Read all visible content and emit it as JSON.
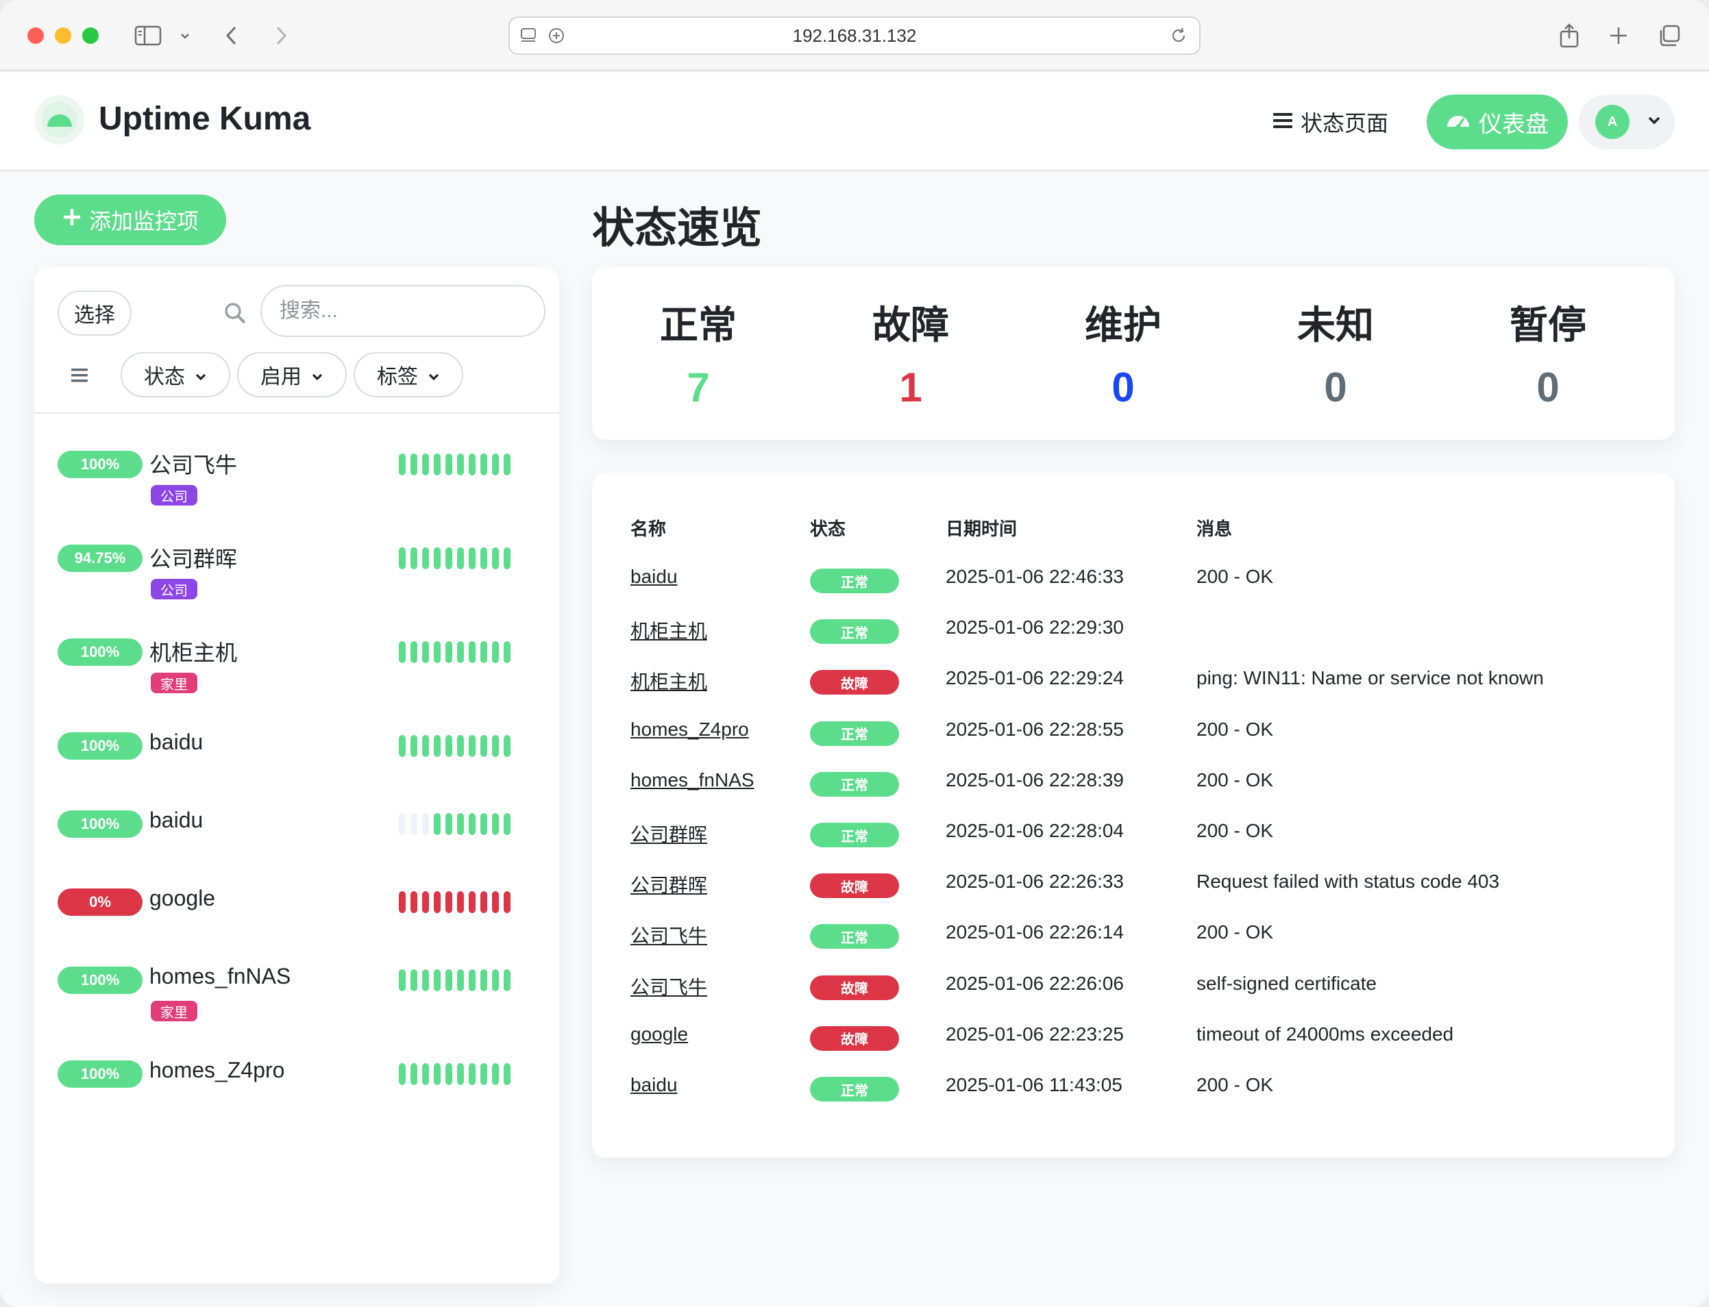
{
  "colors": {
    "up": "#5cdd8b",
    "down": "#dc3545",
    "maintenance": "#1747f5",
    "unknown": "#5f6b75",
    "pending": "#5f6b75",
    "tag_company": "#8c46e6",
    "tag_home": "#e13d78",
    "beat_empty": "#eef3f9"
  },
  "browser": {
    "address": "192.168.31.132"
  },
  "header": {
    "brand": "Uptime Kuma",
    "status_page": "状态页面",
    "dashboard": "仪表盘",
    "avatar_letter": "A"
  },
  "sidebar": {
    "add_monitor": "添加监控项",
    "select": "选择",
    "search_placeholder": "搜索...",
    "filters": [
      "状态",
      "启用",
      "标签"
    ],
    "monitors": [
      {
        "uptime": "100%",
        "name": "公司飞牛",
        "tag": "公司",
        "tag_type": "company",
        "status": "up",
        "beats": [
          "up",
          "up",
          "up",
          "up",
          "up",
          "up",
          "up",
          "up",
          "up",
          "up"
        ]
      },
      {
        "uptime": "94.75%",
        "name": "公司群晖",
        "tag": "公司",
        "tag_type": "company",
        "status": "up",
        "beats": [
          "up",
          "up",
          "up",
          "up",
          "up",
          "up",
          "up",
          "up",
          "up",
          "up"
        ]
      },
      {
        "uptime": "100%",
        "name": "机柜主机",
        "tag": "家里",
        "tag_type": "home",
        "status": "up",
        "beats": [
          "up",
          "up",
          "up",
          "up",
          "up",
          "up",
          "up",
          "up",
          "up",
          "up"
        ]
      },
      {
        "uptime": "100%",
        "name": "baidu",
        "tag": "",
        "tag_type": "",
        "status": "up",
        "beats": [
          "up",
          "up",
          "up",
          "up",
          "up",
          "up",
          "up",
          "up",
          "up",
          "up"
        ]
      },
      {
        "uptime": "100%",
        "name": "baidu",
        "tag": "",
        "tag_type": "",
        "status": "up",
        "beats": [
          "empty",
          "empty",
          "empty",
          "up",
          "up",
          "up",
          "up",
          "up",
          "up",
          "up"
        ]
      },
      {
        "uptime": "0%",
        "name": "google",
        "tag": "",
        "tag_type": "",
        "status": "down",
        "beats": [
          "down",
          "down",
          "down",
          "down",
          "down",
          "down",
          "down",
          "down",
          "down",
          "down"
        ]
      },
      {
        "uptime": "100%",
        "name": "homes_fnNAS",
        "tag": "家里",
        "tag_type": "home",
        "status": "up",
        "beats": [
          "up",
          "up",
          "up",
          "up",
          "up",
          "up",
          "up",
          "up",
          "up",
          "up"
        ]
      },
      {
        "uptime": "100%",
        "name": "homes_Z4pro",
        "tag": "",
        "tag_type": "",
        "status": "up",
        "beats": [
          "up",
          "up",
          "up",
          "up",
          "up",
          "up",
          "up",
          "up",
          "up",
          "up"
        ]
      }
    ]
  },
  "main": {
    "title": "状态速览",
    "stats": [
      {
        "label": "正常",
        "value": "7",
        "color": "#5cdd8b"
      },
      {
        "label": "故障",
        "value": "1",
        "color": "#dc3545"
      },
      {
        "label": "维护",
        "value": "0",
        "color": "#1747f5"
      },
      {
        "label": "未知",
        "value": "0",
        "color": "#5f6b75"
      },
      {
        "label": "暂停",
        "value": "0",
        "color": "#5f6b75"
      }
    ],
    "events_headers": [
      "名称",
      "状态",
      "日期时间",
      "消息"
    ],
    "events": [
      {
        "name": "baidu",
        "status": "正常",
        "type": "up",
        "time": "2025-01-06 22:46:33",
        "msg": "200 - OK"
      },
      {
        "name": "机柜主机",
        "status": "正常",
        "type": "up",
        "time": "2025-01-06 22:29:30",
        "msg": ""
      },
      {
        "name": "机柜主机",
        "status": "故障",
        "type": "down",
        "time": "2025-01-06 22:29:24",
        "msg": "ping: WIN11: Name or service not known"
      },
      {
        "name": "homes_Z4pro",
        "status": "正常",
        "type": "up",
        "time": "2025-01-06 22:28:55",
        "msg": "200 - OK"
      },
      {
        "name": "homes_fnNAS",
        "status": "正常",
        "type": "up",
        "time": "2025-01-06 22:28:39",
        "msg": "200 - OK"
      },
      {
        "name": "公司群晖",
        "status": "正常",
        "type": "up",
        "time": "2025-01-06 22:28:04",
        "msg": "200 - OK"
      },
      {
        "name": "公司群晖",
        "status": "故障",
        "type": "down",
        "time": "2025-01-06 22:26:33",
        "msg": "Request failed with status code 403"
      },
      {
        "name": "公司飞牛",
        "status": "正常",
        "type": "up",
        "time": "2025-01-06 22:26:14",
        "msg": "200 - OK"
      },
      {
        "name": "公司飞牛",
        "status": "故障",
        "type": "down",
        "time": "2025-01-06 22:26:06",
        "msg": "self-signed certificate"
      },
      {
        "name": "google",
        "status": "故障",
        "type": "down",
        "time": "2025-01-06 22:23:25",
        "msg": "timeout of 24000ms exceeded"
      },
      {
        "name": "baidu",
        "status": "正常",
        "type": "up",
        "time": "2025-01-06 11:43:05",
        "msg": "200 - OK"
      }
    ]
  }
}
